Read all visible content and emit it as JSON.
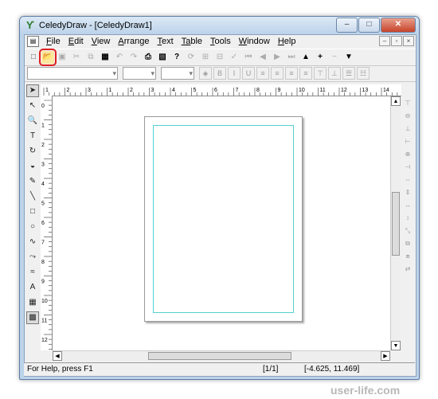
{
  "window": {
    "title": "CeledyDraw - [CeledyDraw1]",
    "icon": "celedydraw-app-icon"
  },
  "menu": [
    {
      "key": "F",
      "rest": "ile"
    },
    {
      "key": "E",
      "rest": "dit"
    },
    {
      "key": "V",
      "rest": "iew"
    },
    {
      "key": "A",
      "rest": "rrange"
    },
    {
      "key": "T",
      "rest": "ext"
    },
    {
      "key": "Ta",
      "rest": "ble"
    },
    {
      "key": "T",
      "rest": "ools"
    },
    {
      "key": "W",
      "rest": "indow"
    },
    {
      "key": "H",
      "rest": "elp"
    }
  ],
  "toolbar": {
    "highlighted_button": "open-file",
    "highlight_color": "#e02020",
    "buttons": [
      "new",
      "open-file",
      "save",
      "cut",
      "copy",
      "paste",
      "undo",
      "redo",
      "print",
      "print-preview",
      "help",
      "rotate",
      "group",
      "ungroup",
      "spell",
      "first-page",
      "prev-page",
      "next-page",
      "last-page",
      "up",
      "plus",
      "minus",
      "dropdown"
    ]
  },
  "ruler": {
    "h_labels": [
      "1",
      "2",
      "3",
      "1",
      "2",
      "3",
      "4",
      "5",
      "6",
      "7",
      "8",
      "9",
      "10",
      "11",
      "12",
      "13",
      "14"
    ],
    "v_labels": [
      "0",
      "1",
      "2",
      "3",
      "4",
      "5",
      "6",
      "7",
      "8",
      "9",
      "10",
      "11",
      "12"
    ]
  },
  "colors": {
    "margin_guide": "#55d0d0",
    "page_bg": "#ffffff"
  },
  "status": {
    "help": "For Help, press F1",
    "page": "[1/1]",
    "coords": "[-4.625, 11.469]"
  },
  "watermark": "user-life.com"
}
